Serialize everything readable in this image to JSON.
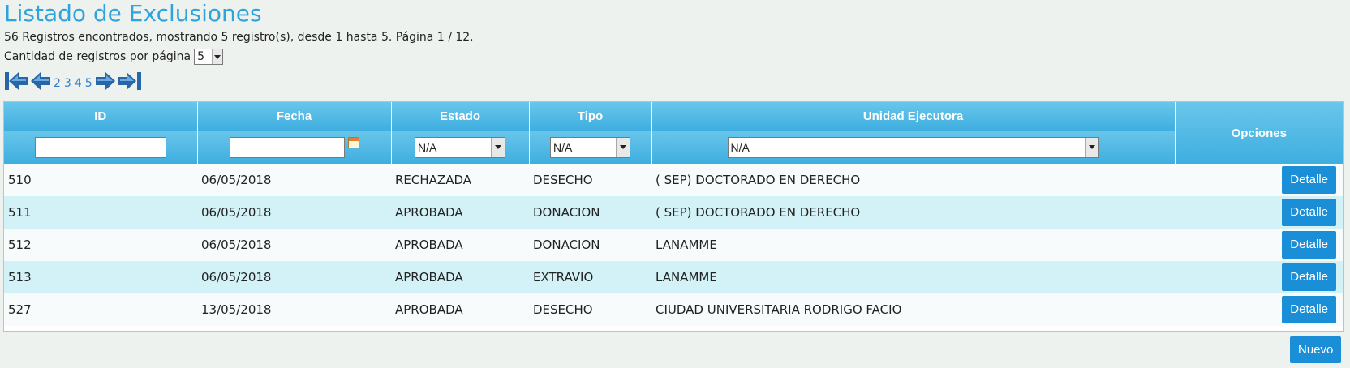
{
  "header": {
    "title": "Listado de Exclusiones",
    "summary": "56 Registros encontrados, mostrando 5 registro(s), desde 1 hasta 5. Página 1 / 12.",
    "per_page_label": "Cantidad de registros por página",
    "per_page_value": "5"
  },
  "pager": {
    "icons": [
      "first-page-icon",
      "previous-page-icon",
      "next-page-icon",
      "last-page-icon"
    ],
    "pages": [
      "2",
      "3",
      "4",
      "5"
    ]
  },
  "table": {
    "columns": [
      "ID",
      "Fecha",
      "Estado",
      "Tipo",
      "Unidad Ejecutora",
      "Opciones"
    ],
    "filters": {
      "estado": "N/A",
      "tipo": "N/A",
      "unidad": "N/A"
    },
    "rows": [
      {
        "id": "510",
        "fecha": "06/05/2018",
        "estado": "RECHAZADA",
        "tipo": "DESECHO",
        "unidad": "( SEP) DOCTORADO EN DERECHO",
        "action": "Detalle"
      },
      {
        "id": "511",
        "fecha": "06/05/2018",
        "estado": "APROBADA",
        "tipo": "DONACION",
        "unidad": "( SEP) DOCTORADO EN DERECHO",
        "action": "Detalle"
      },
      {
        "id": "512",
        "fecha": "06/05/2018",
        "estado": "APROBADA",
        "tipo": "DONACION",
        "unidad": "LANAMME",
        "action": "Detalle"
      },
      {
        "id": "513",
        "fecha": "06/05/2018",
        "estado": "APROBADA",
        "tipo": "EXTRAVIO",
        "unidad": "LANAMME",
        "action": "Detalle"
      },
      {
        "id": "527",
        "fecha": "13/05/2018",
        "estado": "APROBADA",
        "tipo": "DESECHO",
        "unidad": "CIUDAD UNIVERSITARIA RODRIGO FACIO",
        "action": "Detalle"
      }
    ]
  },
  "footer": {
    "new_label": "Nuevo"
  },
  "colors": {
    "title": "#2fa3dc",
    "header_bg": "#4db6e4",
    "row_even": "#d3f2f7",
    "row_odd": "#f7fbfb",
    "button": "#1a8fd8"
  }
}
